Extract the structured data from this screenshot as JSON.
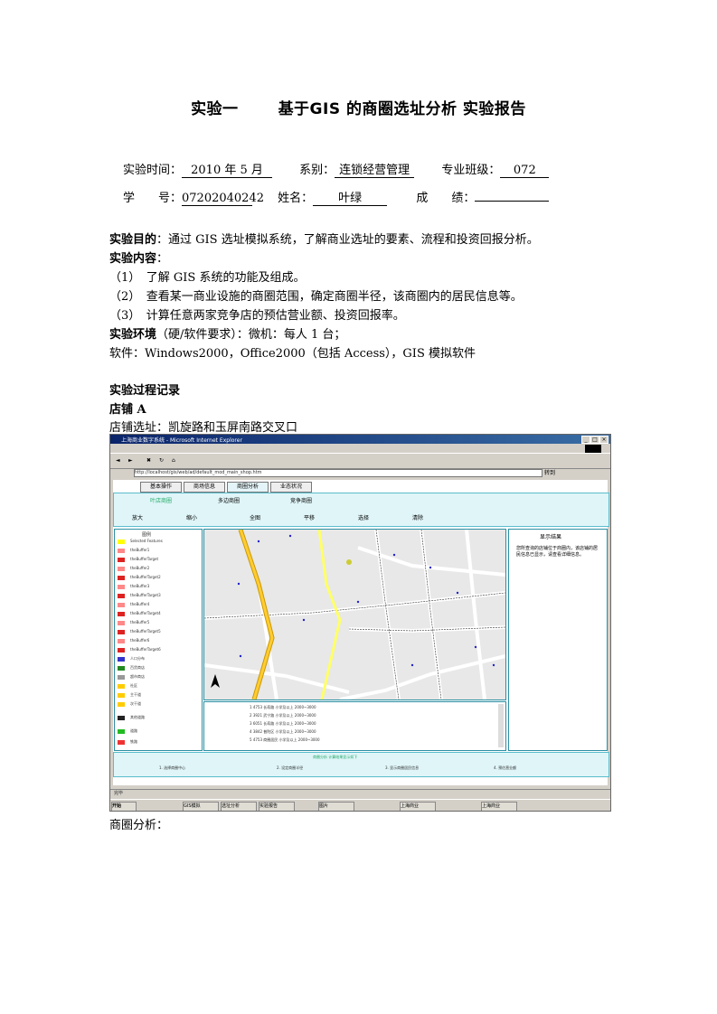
{
  "doc": {
    "title": "实验一",
    "title2": "基于GIS 的商圈选址分析 实验报告",
    "time_label": "实验时间：",
    "time_value": "2010 年 5 月",
    "dept_label": "系别：",
    "dept_value": "连锁经营管理",
    "class_label": "专业班级：",
    "class_value": "072",
    "id_label": "学　　号：",
    "id_value": "07202040242",
    "name_label": "姓名：",
    "name_value": "叶绿",
    "score_label": "成　　绩：",
    "score_value": "",
    "purpose_label": "实验目的",
    "purpose_text": "：通过 GIS 选址模拟系统，了解商业选址的要素、流程和投资回报分析。",
    "content_label": "实验内容",
    "content_colon": "：",
    "item1": "（1）　了解 GIS 系统的功能及组成。",
    "item2": "（2）　查看某一商业设施的商圈范围，确定商圈半径，该商圈内的居民信息等。",
    "item3": "（3）　计算任意两家竞争店的预估营业额、投资回报率。",
    "env_label": "实验环境",
    "env_text": "（硬/软件要求）：微机：每人 1 台；",
    "software": "软件：Windows2000，Office2000（包括 Access），GIS 模拟软件",
    "process": "实验过程记录",
    "store": "店铺 A",
    "site": "店铺选址：凯旋路和玉屏南路交叉口",
    "analysis": "商圈分析："
  },
  "screenshot": {
    "window_title": "上海商业数字系统 - Microsoft Internet Explorer",
    "address": "http://localhost/gis/web/ad/default_mod_main_shop.htm",
    "address_go": "转到",
    "tabs": [
      "基本操作",
      "商场信息",
      "商圈分析",
      "业态状况"
    ],
    "subnav_links": [
      "叶店商圈",
      "多边商圈",
      "竞争商圈"
    ],
    "tools": [
      "放大",
      "缩小",
      "全图",
      "平移",
      "选择",
      "清除"
    ],
    "legend_title": "图例",
    "legend": [
      "Selected Features",
      "theBuffer1",
      "theBufferTarget",
      "theBuffer2",
      "theBufferTarget2",
      "theBuffer3",
      "theBufferTarget3",
      "theBuffer4",
      "theBufferTarget4",
      "theBuffer5",
      "theBufferTarget5",
      "theBuffer6",
      "theBufferTarget6",
      "人口分布",
      "百货商店",
      "超市商店",
      "社区",
      "主干道",
      "次干道",
      "其他道路",
      "道路",
      "铁路"
    ],
    "info_title": "显示结果",
    "info_text": "您所查询的店铺位于商圈内，该店铺的居民信息已显示，请查看详细信息。",
    "table_rows": [
      "1  4753  长寿路  小学及以上  2000~3000",
      "2  3921  武宁路  小学及以上  2000~3000",
      "3  6051  长寿路  小学及以上  2000~3000",
      "4  3842  普陀区  小学及以上  2000~3000",
      "5  4753  商圈居民  小学及以上  2000~3000"
    ],
    "bottom_title": "商圈分析  计算结果显示如下",
    "bottom_items": [
      "1. 选择商圈中心",
      "2. 设定商圈半径",
      "3. 显示商圈居民信息",
      "4. 预估营业额"
    ],
    "status": "完毕",
    "taskbar": [
      "开始",
      "GIS模拟",
      "选址分析",
      "实验报告",
      "图片",
      "上海商业",
      "上海商业"
    ]
  }
}
